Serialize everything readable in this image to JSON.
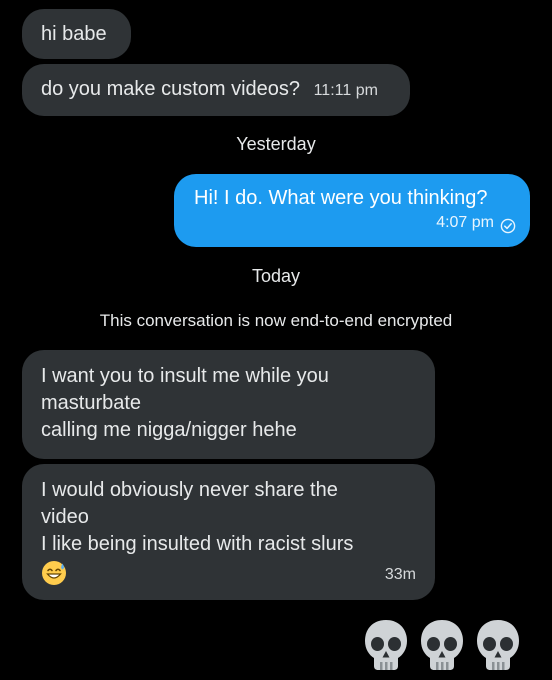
{
  "messages": [
    {
      "id": "m1",
      "text": "hi babe"
    },
    {
      "id": "m2",
      "text": "do you make custom videos?",
      "time": "11:11 pm"
    },
    {
      "id": "m3",
      "text": "Hi! I do. What were you thinking?",
      "time": "4:07 pm"
    },
    {
      "id": "m4",
      "lines": [
        "I want you to insult me while you",
        "masturbate",
        "calling me nigga/nigger hehe"
      ]
    },
    {
      "id": "m5",
      "lines": [
        "I would obviously never share the",
        "video",
        "I like being insulted with racist slurs"
      ],
      "emoji": "grinning-sweat-emoji",
      "time": "33m"
    }
  ],
  "dividers": {
    "yesterday": "Yesterday",
    "today": "Today",
    "encryption_notice": "This conversation is now end-to-end encrypted"
  },
  "reactions": [
    "skull-emoji",
    "skull-emoji",
    "skull-emoji"
  ],
  "colors": {
    "background": "#000000",
    "incoming_bubble": "#2f3336",
    "outgoing_bubble": "#1d9bf0",
    "text": "#e7e9ea"
  }
}
